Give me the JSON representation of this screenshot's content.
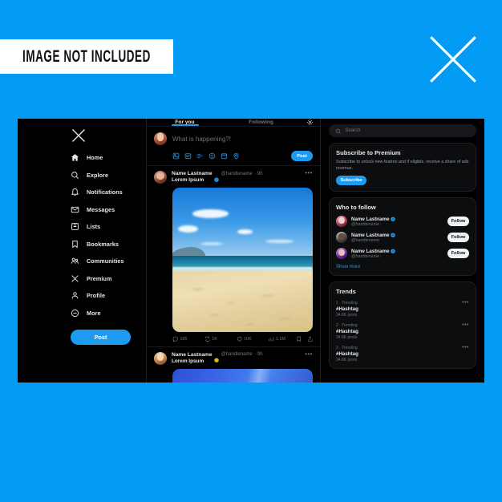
{
  "banner": {
    "text": "IMAGE NOT INCLUDED"
  },
  "brand": {
    "logo_icon": "x-logo-icon",
    "accent": "#1d9bf0",
    "background": "#039BF4",
    "app_background": "#000000"
  },
  "sidebar": {
    "logo_icon": "x-logo-icon",
    "items": [
      {
        "label": "Home",
        "icon": "home-icon"
      },
      {
        "label": "Explore",
        "icon": "search-icon"
      },
      {
        "label": "Notifications",
        "icon": "bell-icon"
      },
      {
        "label": "Messages",
        "icon": "envelope-icon"
      },
      {
        "label": "Lists",
        "icon": "list-icon"
      },
      {
        "label": "Bookmarks",
        "icon": "bookmark-icon"
      },
      {
        "label": "Communities",
        "icon": "communities-icon"
      },
      {
        "label": "Premium",
        "icon": "x-logo-icon"
      },
      {
        "label": "Profile",
        "icon": "person-icon"
      },
      {
        "label": "More",
        "icon": "more-circle-icon"
      }
    ],
    "post_button": "Post"
  },
  "feed": {
    "tabs": [
      {
        "label": "For you",
        "active": true
      },
      {
        "label": "Following",
        "active": false
      }
    ],
    "settings_icon": "gear-icon",
    "composer": {
      "placeholder": "What is happening?!",
      "post_button": "Post",
      "icons": [
        "media-icon",
        "gif-icon",
        "poll-icon",
        "emoji-icon",
        "schedule-icon",
        "location-icon"
      ]
    },
    "posts": [
      {
        "name": "Name Lastname",
        "verified_icon": "verified-badge-icon",
        "handle": "@handlename",
        "time": "9h",
        "body": "Lorem Ipsum",
        "more_icon": "more-horizontal-icon",
        "media": "beach-photo",
        "actions": [
          {
            "icon": "reply-icon",
            "count": "185"
          },
          {
            "icon": "repost-icon",
            "count": "1K"
          },
          {
            "icon": "like-icon",
            "count": "10K"
          },
          {
            "icon": "views-icon",
            "count": "1.1M"
          },
          {
            "icon": "bookmark-icon",
            "count": ""
          },
          {
            "icon": "share-icon",
            "count": ""
          }
        ]
      },
      {
        "name": "Name Lastname",
        "verified_icon": "verified-badge-gold-icon",
        "handle": "@handlename",
        "time": "9h",
        "body": "Lorem Ipsum",
        "more_icon": "more-horizontal-icon",
        "media": "blue-photo"
      }
    ]
  },
  "right": {
    "search": {
      "placeholder": "Search",
      "icon": "search-icon"
    },
    "premium": {
      "title": "Subscribe to Premium",
      "description": "Subscribe to unlock new featres and if eligible, receive a share of ads revenue.",
      "button": "Subscribe"
    },
    "who_to_follow": {
      "title": "Who to follow",
      "users": [
        {
          "name": "Name Lastname",
          "handle": "@handlename",
          "verified_icon": "verified-badge-icon",
          "button": "Follow"
        },
        {
          "name": "Name Lastname",
          "handle": "@handlename",
          "verified_icon": "verified-badge-icon",
          "button": "Follow"
        },
        {
          "name": "Name Lastname",
          "handle": "@handlename",
          "verified_icon": "verified-badge-icon",
          "button": "Follow"
        }
      ],
      "show_more": "Show more"
    },
    "trends": {
      "title": "Trends",
      "items": [
        {
          "rank": "1 · Trending",
          "tag": "#Hashtag",
          "count": "34.8K posts",
          "more_icon": "more-horizontal-icon"
        },
        {
          "rank": "2 · Trending",
          "tag": "#Hashtag",
          "count": "34.8K posts",
          "more_icon": "more-horizontal-icon"
        },
        {
          "rank": "3 · Trending",
          "tag": "#Hashtag",
          "count": "34.8K posts",
          "more_icon": "more-horizontal-icon"
        }
      ]
    }
  }
}
